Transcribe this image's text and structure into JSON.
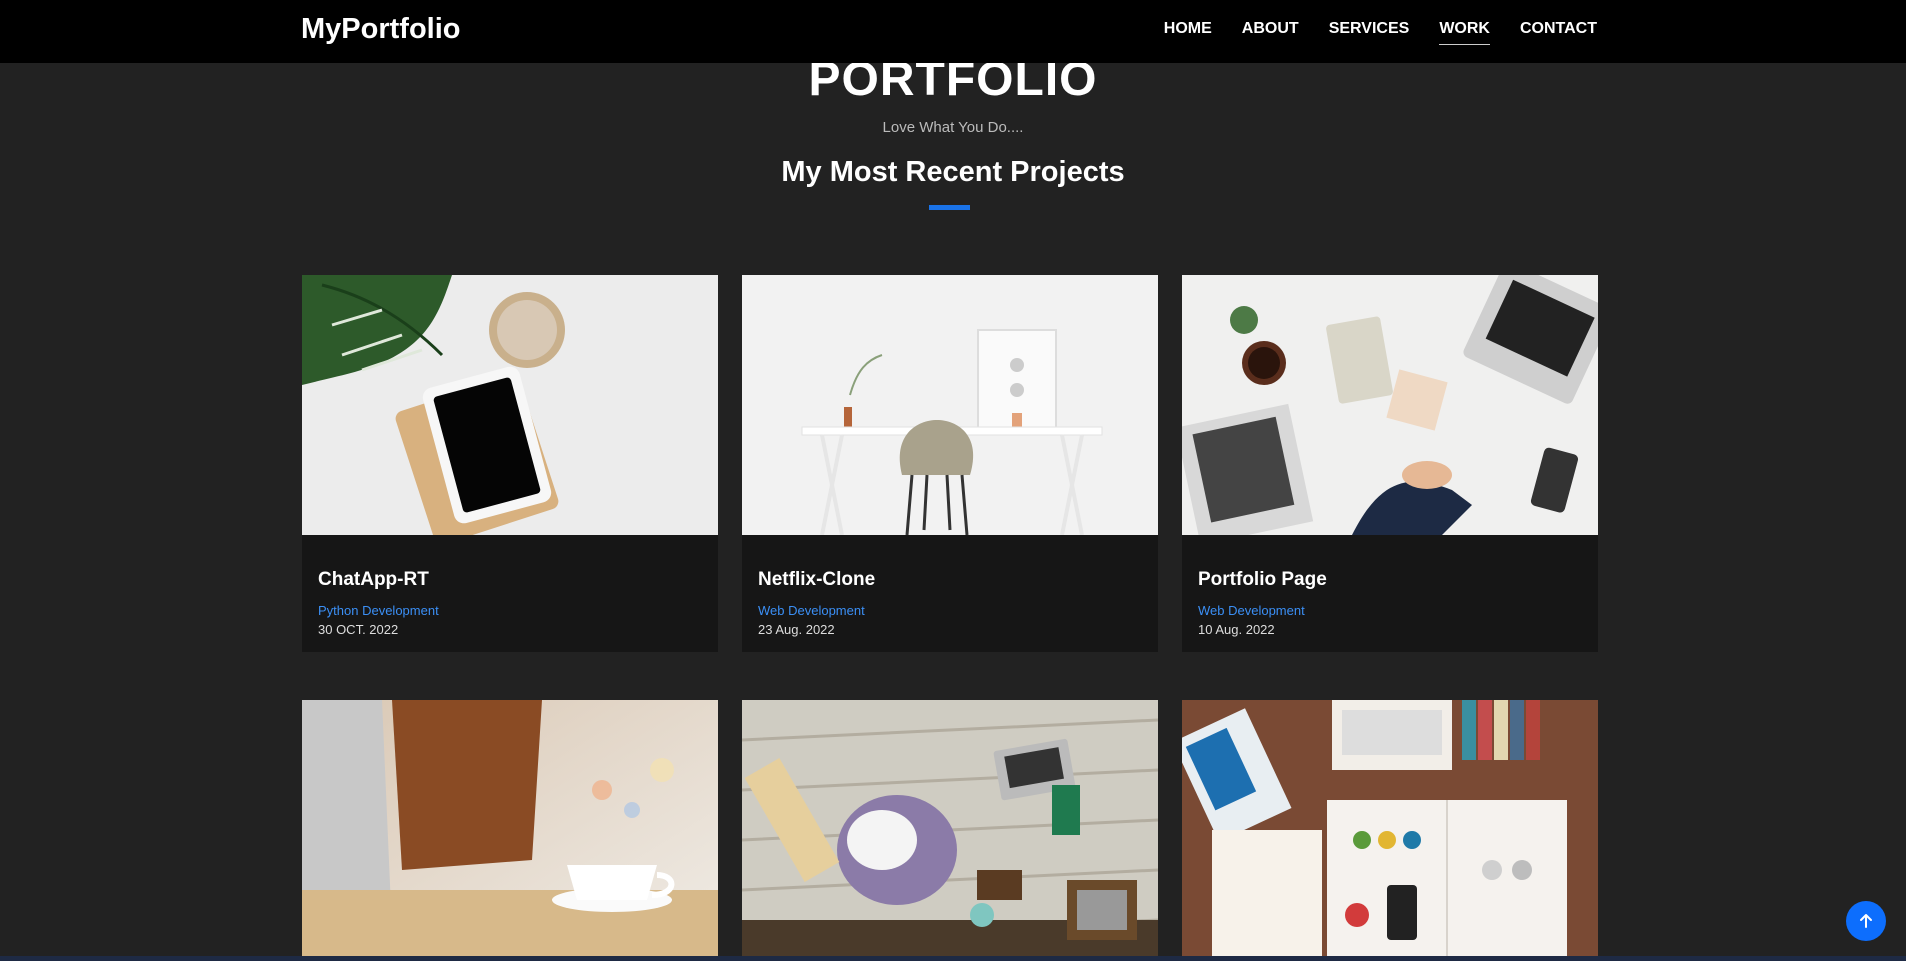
{
  "nav": {
    "brand": "MyPortfolio",
    "links": [
      "HOME",
      "ABOUT",
      "SERVICES",
      "WORK",
      "CONTACT"
    ],
    "active": "WORK"
  },
  "section": {
    "title": "PORTFOLIO",
    "subtitle": "Love What You Do....",
    "heading": "My Most Recent Projects",
    "accent_color": "#1a73e8"
  },
  "projects": [
    {
      "title": "ChatApp-RT",
      "category": "Python Development",
      "date": "30 OCT. 2022",
      "image": "monstera-tablet-coffee-photo"
    },
    {
      "title": "Netflix-Clone",
      "category": "Web Development",
      "date": "23 Aug. 2022",
      "image": "white-desk-chair-photo"
    },
    {
      "title": "Portfolio Page",
      "category": "Web Development",
      "date": "10 Aug. 2022",
      "image": "business-desk-laptop-photo"
    },
    {
      "image": "laptop-bag-coffee-photo"
    },
    {
      "image": "flowers-craft-table-photo"
    },
    {
      "image": "design-books-desk-photo"
    }
  ],
  "scroll_top_icon": "arrow-up-icon"
}
